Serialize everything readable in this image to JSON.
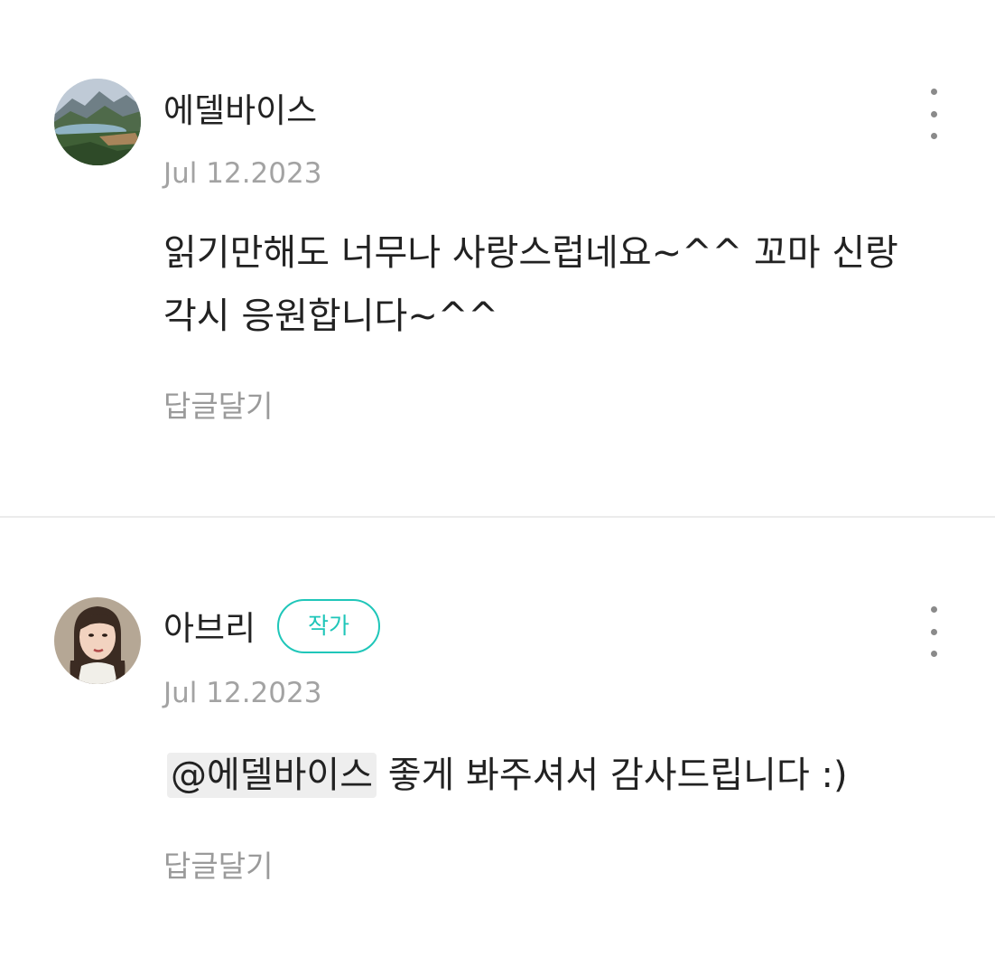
{
  "comments": [
    {
      "username": "에델바이스",
      "date": "Jul 12.2023",
      "body": "읽기만해도 너무나 사랑스럽네요~^^ 꼬마 신랑\n각시 응원합니다~^^",
      "reply_label": "답글달기",
      "avatar_icon": "landscape-avatar"
    },
    {
      "username": "아브리",
      "badge": "작가",
      "date": "Jul 12.2023",
      "mention": "@에델바이스",
      "body": "좋게 봐주셔서 감사드립니다 :)",
      "reply_label": "답글달기",
      "avatar_icon": "illustrated-woman-avatar"
    }
  ],
  "colors": {
    "accent": "#1fc6b9",
    "muted_text": "#a3a3a3",
    "divider": "#ebebeb"
  }
}
